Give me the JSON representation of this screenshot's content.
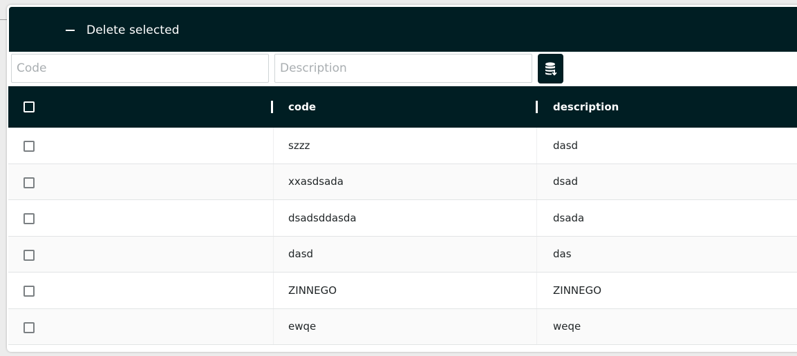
{
  "toolbar": {
    "delete_label": "Delete selected"
  },
  "filters": {
    "code_placeholder": "Code",
    "description_placeholder": "Description",
    "export_icon": "database-download-icon"
  },
  "table": {
    "columns": [
      "",
      "code",
      "description"
    ],
    "rows": [
      {
        "code": "szzz",
        "description": "dasd"
      },
      {
        "code": "xxasdsada",
        "description": "dsad"
      },
      {
        "code": "dsadsddasda",
        "description": "dsada"
      },
      {
        "code": "dasd",
        "description": "das"
      },
      {
        "code": "ZINNEGO",
        "description": "ZINNEGO"
      },
      {
        "code": "ewqe",
        "description": "weqe"
      }
    ]
  },
  "colors": {
    "header_bg": "#001e23",
    "header_text": "#ffffff"
  }
}
